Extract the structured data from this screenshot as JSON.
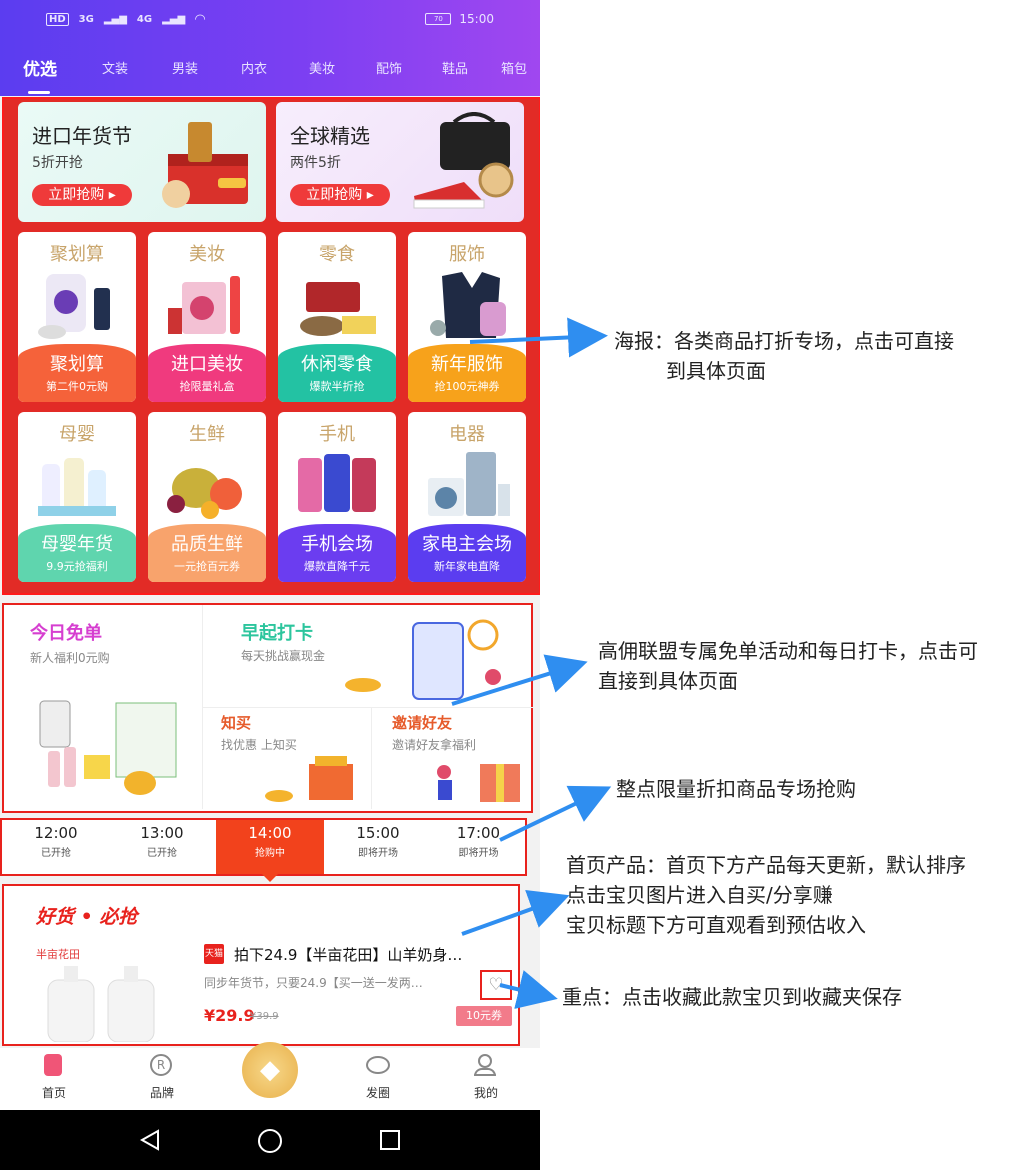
{
  "status_bar": {
    "network": "HD",
    "signal_1": "3G",
    "signal_2": "4G",
    "battery": "70",
    "time": "15:00"
  },
  "tabs": [
    "优选",
    "文装",
    "男装",
    "内衣",
    "美妆",
    "配饰",
    "鞋品",
    "箱包"
  ],
  "banners": [
    {
      "title": "进口年货节",
      "subtitle": "5折开抢",
      "button": "立即抢购 ▸"
    },
    {
      "title": "全球精选",
      "subtitle": "两件5折",
      "button": "立即抢购 ▸"
    }
  ],
  "categories": [
    {
      "top": "聚划算",
      "title": "聚划算",
      "sub": "第二件0元购",
      "color": "#f5623a"
    },
    {
      "top": "美妆",
      "title": "进口美妆",
      "sub": "抢限量礼盒",
      "color": "#f03a7e"
    },
    {
      "top": "零食",
      "title": "休闲零食",
      "sub": "爆款半折抢",
      "color": "#23c2a3"
    },
    {
      "top": "服饰",
      "title": "新年服饰",
      "sub": "抢100元神券",
      "color": "#f7a21b"
    },
    {
      "top": "母婴",
      "title": "母婴年货",
      "sub": "9.9元抢福利",
      "color": "#5fd5ae"
    },
    {
      "top": "生鲜",
      "title": "品质生鲜",
      "sub": "一元抢百元券",
      "color": "#f8a36c"
    },
    {
      "top": "手机",
      "title": "手机会场",
      "sub": "爆款直降千元",
      "color": "#6b3df0"
    },
    {
      "top": "电器",
      "title": "家电主会场",
      "sub": "新年家电直降",
      "color": "#5b3df0"
    }
  ],
  "activities": {
    "free": {
      "title": "今日免单",
      "sub": "新人福利0元购",
      "color": "#d63fd0"
    },
    "checkin": {
      "title": "早起打卡",
      "sub": "每天挑战赢现金",
      "color": "#2cc59d"
    },
    "zhimai": {
      "title": "知买",
      "sub": "找优惠 上知买",
      "color": "#e65b2b"
    },
    "invite": {
      "title": "邀请好友",
      "sub": "邀请好友拿福利",
      "color": "#e65b2b"
    }
  },
  "flash_sale": [
    {
      "time": "12:00",
      "status": "已开抢",
      "active": false
    },
    {
      "time": "13:00",
      "status": "已开抢",
      "active": false
    },
    {
      "time": "14:00",
      "status": "抢购中",
      "active": true
    },
    {
      "time": "15:00",
      "status": "即将开场",
      "active": false
    },
    {
      "time": "17:00",
      "status": "即将开场",
      "active": false
    }
  ],
  "product_section": {
    "header": "好货 • 必抢",
    "brand": "半亩花田",
    "shop_tag": "天猫",
    "title": "拍下24.9【半亩花田】山羊奶身…",
    "desc": "同步年货节，只要24.9【买一送一发两…",
    "price": "¥29.9",
    "orig_price": "¥39.9",
    "coupon": "10元券"
  },
  "bottom_nav": [
    {
      "label": "首页",
      "icon": "home-tag-icon"
    },
    {
      "label": "品牌",
      "icon": "registered-icon"
    },
    {
      "label": "",
      "icon": "diamond-icon"
    },
    {
      "label": "发圈",
      "icon": "planet-icon"
    },
    {
      "label": "我的",
      "icon": "user-icon"
    }
  ],
  "annotations": {
    "poster": [
      "海报：各类商品打折专场，点击可直接",
      "到具体页面"
    ],
    "activity": [
      "高佣联盟专属免单活动和每日打卡，点击可",
      "直接到具体页面"
    ],
    "flash": "整点限量折扣商品专场抢购",
    "product": [
      "首页产品：首页下方产品每天更新，默认排序",
      "点击宝贝图片进入自买/分享赚",
      "宝贝标题下方可直观看到预估收入"
    ],
    "favorite": "重点：点击收藏此款宝贝到收藏夹保存"
  },
  "colors": {
    "accent_red": "#e8221d",
    "arrow_blue": "#2f8ef0",
    "header_purple": "#6a3ef0"
  }
}
